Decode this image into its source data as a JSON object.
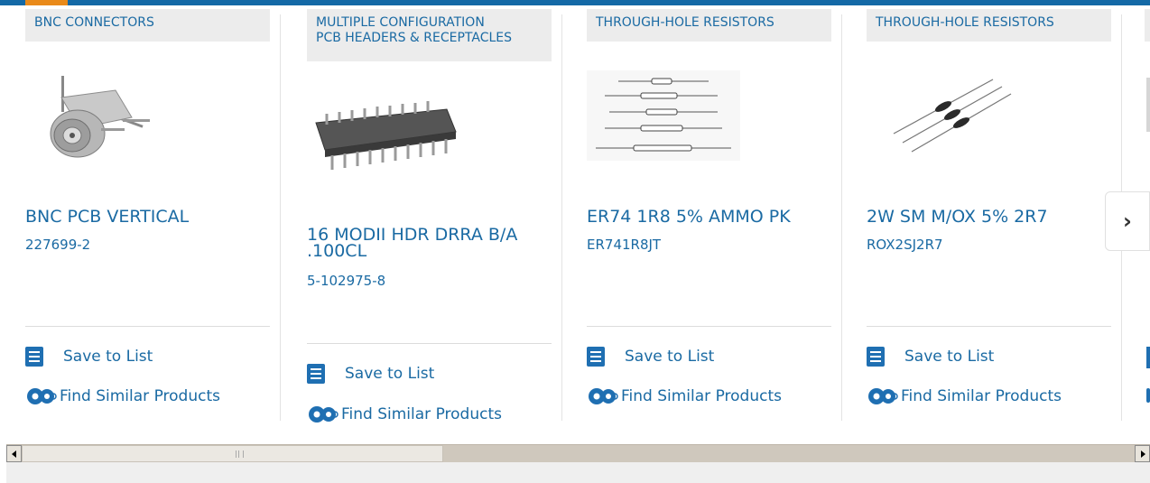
{
  "cards": [
    {
      "category": [
        "BNC CONNECTORS"
      ],
      "title": "BNC PCB VERTICAL",
      "part_number": "227699-2",
      "save_label": "Save to List",
      "similar_label": "Find Similar Products"
    },
    {
      "category": [
        "MULTIPLE CONFIGURATION",
        "PCB HEADERS & RECEPTACLES"
      ],
      "title": "16 MODII HDR DRRA B/A .100CL",
      "part_number": "5-102975-8",
      "save_label": "Save to List",
      "similar_label": "Find Similar Products"
    },
    {
      "category": [
        "THROUGH-HOLE RESISTORS"
      ],
      "title": "ER74 1R8 5% AMMO PK",
      "part_number": "ER741R8JT",
      "save_label": "Save to List",
      "similar_label": "Find Similar Products"
    },
    {
      "category": [
        "THROUGH-HOLE RESISTORS"
      ],
      "title": "2W SM M/OX 5% 2R7",
      "part_number": "ROX2SJ2R7",
      "save_label": "Save to List",
      "similar_label": "Find Similar Products"
    }
  ],
  "carousel": {
    "next_icon": "chevron-right-icon",
    "next_glyph": "›"
  },
  "colors": {
    "link": "#1a6aa3",
    "accent_bar": "#1469a6",
    "accent_orange": "#e98a1a",
    "category_bg": "#ececec"
  }
}
